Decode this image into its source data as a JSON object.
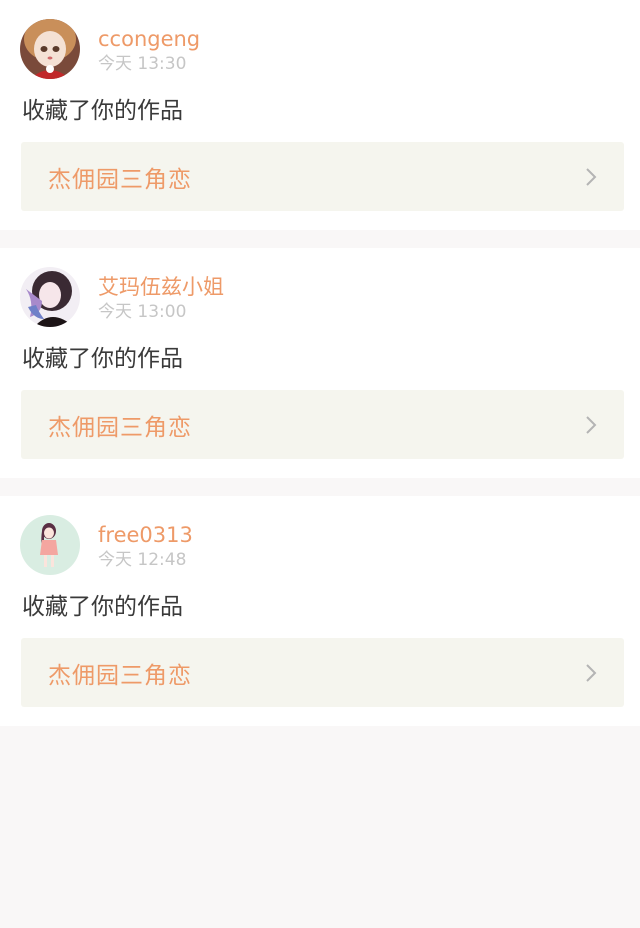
{
  "notifications": [
    {
      "username": "ccongeng",
      "time": "今天 13:30",
      "action": "收藏了你的作品",
      "work_title": "杰佣园三角恋",
      "avatar_icon": "doll-avatar-icon"
    },
    {
      "username": "艾玛伍兹小姐",
      "time": "今天 13:00",
      "action": "收藏了你的作品",
      "work_title": "杰佣园三角恋",
      "avatar_icon": "anime-girl-avatar-icon"
    },
    {
      "username": "free0313",
      "time": "今天 12:48",
      "action": "收藏了你的作品",
      "work_title": "杰佣园三角恋",
      "avatar_icon": "cartoon-girl-avatar-icon"
    }
  ],
  "colors": {
    "accent": "#ee9a68",
    "link_bg": "#f5f5ee",
    "page_bg": "#f9f7f7"
  }
}
